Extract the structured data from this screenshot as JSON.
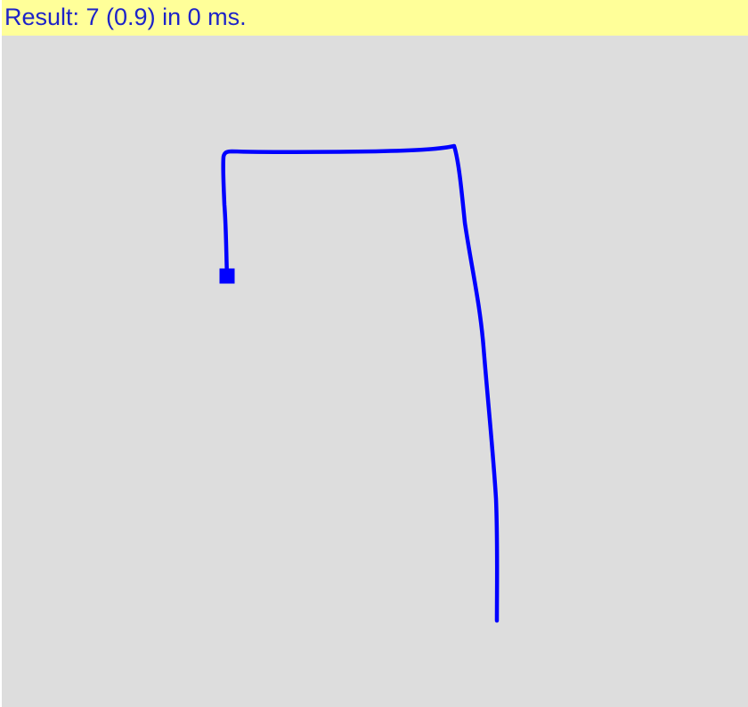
{
  "status": {
    "result_text": "Result: 7 (0.9) in 0 ms."
  },
  "recognition": {
    "digit": 7,
    "confidence": 0.9,
    "time_ms": 0
  },
  "colors": {
    "status_background": "#ffff99",
    "status_text": "#1d23c8",
    "canvas_background": "#dddddd",
    "stroke": "#0000ff"
  },
  "icons": {
    "stroke_end_marker": "square"
  }
}
